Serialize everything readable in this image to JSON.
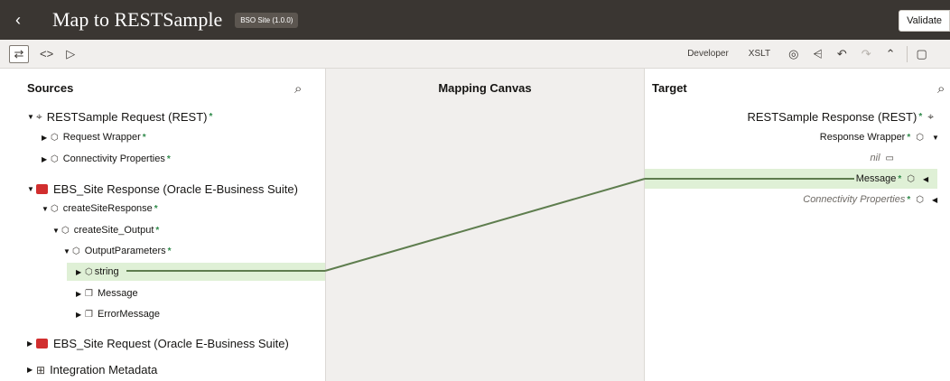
{
  "header": {
    "title": "Map to RESTSample",
    "badge": "BSO Site (1.0.0)",
    "validate": "Validate"
  },
  "toolbar": {
    "developer": "Developer",
    "xslt": "XSLT"
  },
  "sources": {
    "title": "Sources",
    "items": [
      {
        "label": "RESTSample Request (REST)"
      },
      {
        "label": "Request Wrapper"
      },
      {
        "label": "Connectivity Properties"
      },
      {
        "label": "EBS_Site Response (Oracle E-Business Suite)"
      },
      {
        "label": "createSiteResponse"
      },
      {
        "label": "createSite_Output"
      },
      {
        "label": "OutputParameters"
      },
      {
        "label": "string"
      },
      {
        "label": "Message"
      },
      {
        "label": "ErrorMessage"
      },
      {
        "label": "EBS_Site Request (Oracle E-Business Suite)"
      },
      {
        "label": "Integration Metadata"
      }
    ]
  },
  "canvas": {
    "title": "Mapping Canvas"
  },
  "target": {
    "title": "Target",
    "items": [
      {
        "label": "RESTSample Response (REST)"
      },
      {
        "label": "Response Wrapper"
      },
      {
        "label": "nil"
      },
      {
        "label": "Message"
      },
      {
        "label": "Connectivity Properties"
      }
    ]
  },
  "colors": {
    "mapping_line": "#5e7d4e",
    "highlight": "#dff0d6",
    "required": "#2f8a4a",
    "header": "#3a3632"
  }
}
